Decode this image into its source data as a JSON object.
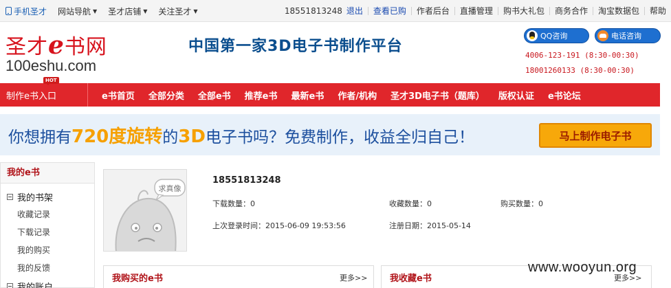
{
  "topbar": {
    "mobile": "手机圣才",
    "site_nav": "网站导航",
    "store": "圣才店铺",
    "follow": "关注圣才",
    "user_phone": "18551813248",
    "logout": "退出",
    "view_bought": "查看已购",
    "author_backend": "作者后台",
    "live_manage": "直播管理",
    "gift_pack": "购书大礼包",
    "business": "商务合作",
    "taobao": "淘宝数据包",
    "help": "帮助"
  },
  "header": {
    "logo_cn_1": "圣才",
    "logo_cn_e": "e",
    "logo_cn_2": "书网",
    "logo_en": "100eshu.com",
    "slogan": "中国第一家3D电子书制作平台",
    "qq_label": "QQ咨询",
    "tel_label": "电话咨询",
    "hotline_1": "4006-123-191 (8:30-00:30)",
    "hotline_2": "18001260133 (8:30-00:30)"
  },
  "nav": {
    "entry": "制作e书入口",
    "hot": "HOT",
    "links": [
      "e书首页",
      "全部分类",
      "全部e书",
      "推荐e书",
      "最新e书",
      "作者/机构",
      "圣才3D电子书（题库）",
      "版权认证",
      "e书论坛"
    ]
  },
  "banner": {
    "pre": "你想拥有",
    "highlight": "720度旋转",
    "mid": "的",
    "highlight2": "3D",
    "post": "电子书吗？免费制作，收益全归自己！",
    "cta": "马上制作电子书"
  },
  "sidebar": {
    "title": "我的e书",
    "shelf": "我的书架",
    "fav": "收藏记录",
    "download": "下载记录",
    "buy": "我的购买",
    "feedback": "我的反馈",
    "account": "我的账户"
  },
  "profile": {
    "avatar_text": "求真像",
    "username": "18551813248",
    "download_count_label": "下载数量：",
    "download_count": "0",
    "fav_count_label": "收藏数量：",
    "fav_count": "0",
    "buy_count_label": "购买数量：",
    "buy_count": "0",
    "last_login_label": "上次登录时间：",
    "last_login": "2015-06-09 19:53:56",
    "register_label": "注册日期：",
    "register_date": "2015-05-14"
  },
  "panels": {
    "bought_title": "我购买的e书",
    "bought_more": "更多>>",
    "fav_title": "我收藏e书",
    "fav_more": "更多>>"
  },
  "watermark": "www.wooyun.org",
  "colors": {
    "nav_red": "#e0262b",
    "brand_red": "#d7131d",
    "slogan_blue": "#0b4e8e",
    "cta_orange": "#f7a80a"
  }
}
